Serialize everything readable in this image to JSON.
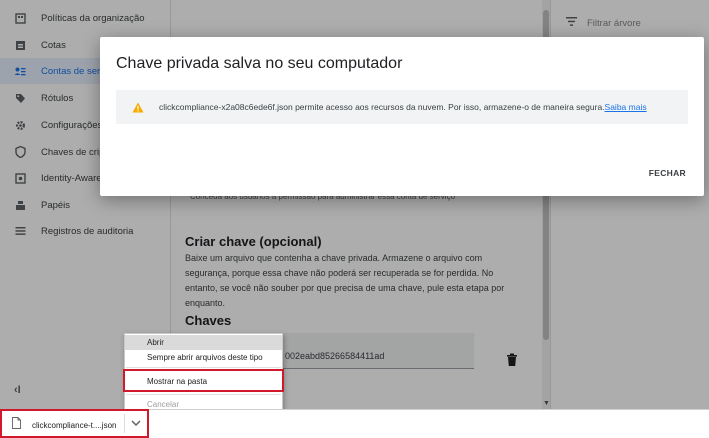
{
  "sidebar": {
    "items": [
      {
        "label": "Políticas da organização",
        "icon": "building-icon"
      },
      {
        "label": "Cotas",
        "icon": "quota-icon"
      },
      {
        "label": "Contas de servi",
        "icon": "service-account-icon",
        "active": true
      },
      {
        "label": "Rótulos",
        "icon": "label-icon"
      },
      {
        "label": "Configurações",
        "icon": "gear-icon"
      },
      {
        "label": "Chaves de cript",
        "icon": "shield-icon"
      },
      {
        "label": "Identity-Aware I",
        "icon": "iap-icon"
      },
      {
        "label": "Papéis",
        "icon": "roles-icon"
      },
      {
        "label": "Registros de auditoria",
        "icon": "list-icon"
      }
    ],
    "collapse_label": "‹I"
  },
  "main": {
    "under_text": "Conceda aos usuários a permissão para administrar essa conta de serviço",
    "create_key_title": "Criar chave (opcional)",
    "create_key_text": "Baixe um arquivo que contenha a chave privada. Armazene o arquivo com segurança, porque essa chave não poderá ser recuperada se for perdida. No entanto, se você não souber por que precisa de uma chave, pule esta etapa por enquanto.",
    "keys_title": "Chaves",
    "key_id": "002eabd85266584411ad"
  },
  "right_panel": {
    "filter_placeholder": "Filtrar árvore"
  },
  "dialog": {
    "title": "Chave privada salva no seu computador",
    "notice_text": "clickcompliance-x2a08c6ede6f.json permite acesso aos recursos da nuvem. Por isso, armazene-o de maneira segura.",
    "notice_link": "Saiba mais",
    "close_label": "FECHAR"
  },
  "context_menu": {
    "items": [
      "Abrir",
      "Sempre abrir arquivos deste tipo",
      "Mostrar na pasta",
      "Cancelar"
    ]
  },
  "download_bar": {
    "file_name": "clickcompliance-t....json"
  },
  "colors": {
    "accent": "#1a73e8",
    "warning": "#f9ab00",
    "highlight_box": "#d01a2c"
  }
}
